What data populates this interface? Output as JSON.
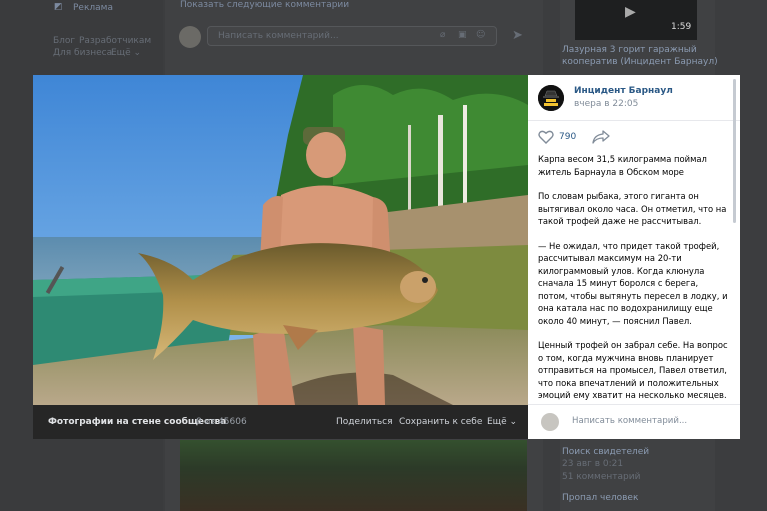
{
  "background": {
    "left_menu": {
      "ads_label": "Реклама",
      "blog": "Блог",
      "developers": "Разработчикам",
      "for_business": "Для бизнеса",
      "more": "Ещё ⌄"
    },
    "feed": {
      "show_more_comments": "Показать следующие комментарии",
      "comment_placeholder": "Написать комментарий..."
    },
    "right_column": {
      "video_duration": "1:59",
      "item1_line1": "Лазурная 3 горит гаражный",
      "item1_line2": "кооператив (Инцидент Барнаул)",
      "item2_title": "Поиск свидетелей",
      "item2_date": "23 авг в 0:21",
      "item2_comments": "51 комментарий",
      "item3_title": "Пропал человек"
    }
  },
  "viewer": {
    "caption": "Фотографии на стене сообщества",
    "counter": "8 из 45606",
    "share_label": "Поделиться",
    "save_label": "Сохранить к себе",
    "more_label": "Ещё ⌄"
  },
  "post": {
    "group_name": "Инцидент Барнаул",
    "time": "вчера в 22:05",
    "likes": "790",
    "paragraphs": [
      "Карпа весом 31,5 килограмма поймал житель Барнаула в Обском море",
      "По словам рыбака, этого гиганта он вытягивал около часа. Он отметил, что на такой трофей даже не рассчитывал.",
      "— Не ожидал, что придет такой трофей, рассчитывал максимум на 20-ти килограммовый улов. Когда клюнула сначала 15 минут боролся с берега, потом, чтобы вытянуть пересел в лодку, и она катала нас по водохранилищу еще около 40 минут, — пояснил Павел.",
      "Ценный трофей он забрал себе. На вопрос о том, когда мужчина вновь планирует отправиться на промысел, Павел ответил, что пока впечатлений и положительных эмоций ему хватит на несколько месяцев."
    ],
    "comment_placeholder": "Написать комментарий..."
  }
}
